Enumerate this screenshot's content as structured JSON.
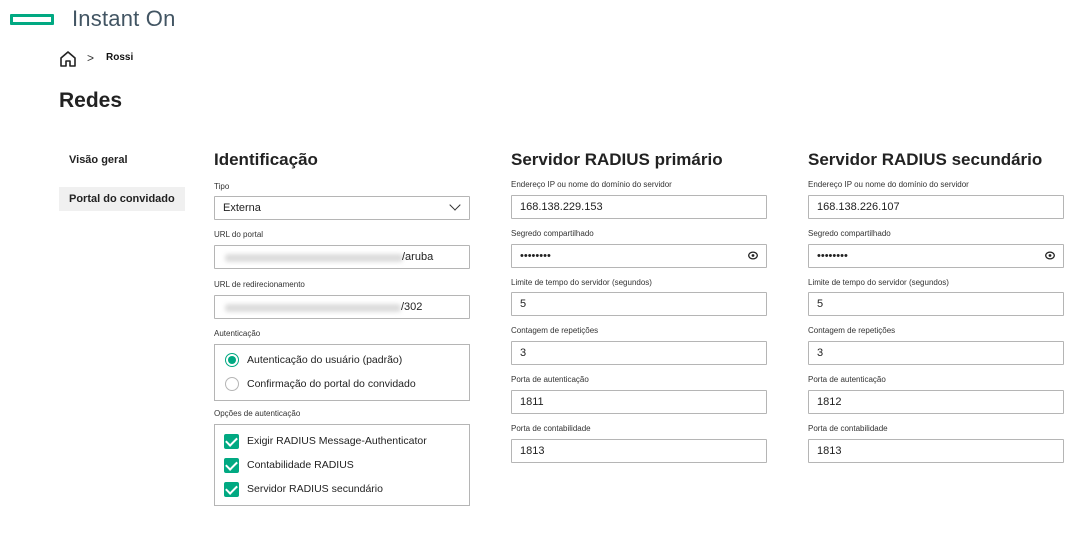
{
  "header": {
    "brand": "Instant On"
  },
  "breadcrumb": {
    "separator": ">",
    "current": "Rossi"
  },
  "page": {
    "title": "Redes"
  },
  "nav": {
    "items": [
      {
        "label": "Visão geral"
      },
      {
        "label": "Portal do convidado"
      }
    ]
  },
  "identification": {
    "title": "Identificação",
    "type_label": "Tipo",
    "type_value": "Externa",
    "portal_url_label": "URL do portal",
    "portal_url_suffix": "/aruba",
    "redirect_url_label": "URL de redirecionamento",
    "redirect_url_suffix": "/302",
    "auth_label": "Autenticação",
    "auth_options": [
      {
        "label": "Autenticação do usuário (padrão)"
      },
      {
        "label": "Confirmação do portal do convidado"
      }
    ],
    "auth_options_label": "Opções de autenticação",
    "checkbox_options": [
      {
        "label": "Exigir RADIUS Message-Authenticator"
      },
      {
        "label": "Contabilidade RADIUS"
      },
      {
        "label": "Servidor RADIUS secundário"
      }
    ]
  },
  "primary": {
    "title": "Servidor RADIUS primário",
    "address_label": "Endereço IP ou nome do domínio do servidor",
    "address_value": "168.138.229.153",
    "secret_label": "Segredo compartilhado",
    "secret_value": "••••••••",
    "timeout_label": "Limite de tempo do servidor (segundos)",
    "timeout_value": "5",
    "retries_label": "Contagem de repetições",
    "retries_value": "3",
    "auth_port_label": "Porta de autenticação",
    "auth_port_value": "1811",
    "acct_port_label": "Porta de contabilidade",
    "acct_port_value": "1813"
  },
  "secondary": {
    "title": "Servidor RADIUS secundário",
    "address_label": "Endereço IP ou nome do domínio do servidor",
    "address_value": "168.138.226.107",
    "secret_label": "Segredo compartilhado",
    "secret_value": "••••••••",
    "timeout_label": "Limite de tempo do servidor (segundos)",
    "timeout_value": "5",
    "retries_label": "Contagem de repetições",
    "retries_value": "3",
    "auth_port_label": "Porta de autenticação",
    "auth_port_value": "1812",
    "acct_port_label": "Porta de contabilidade",
    "acct_port_value": "1813"
  },
  "colors": {
    "accent": "#01a982",
    "border": "#b5b5b5"
  },
  "icons": [
    "logo-bar-icon",
    "home-icon",
    "chevron-down-icon",
    "eye-icon",
    "check-icon"
  ]
}
